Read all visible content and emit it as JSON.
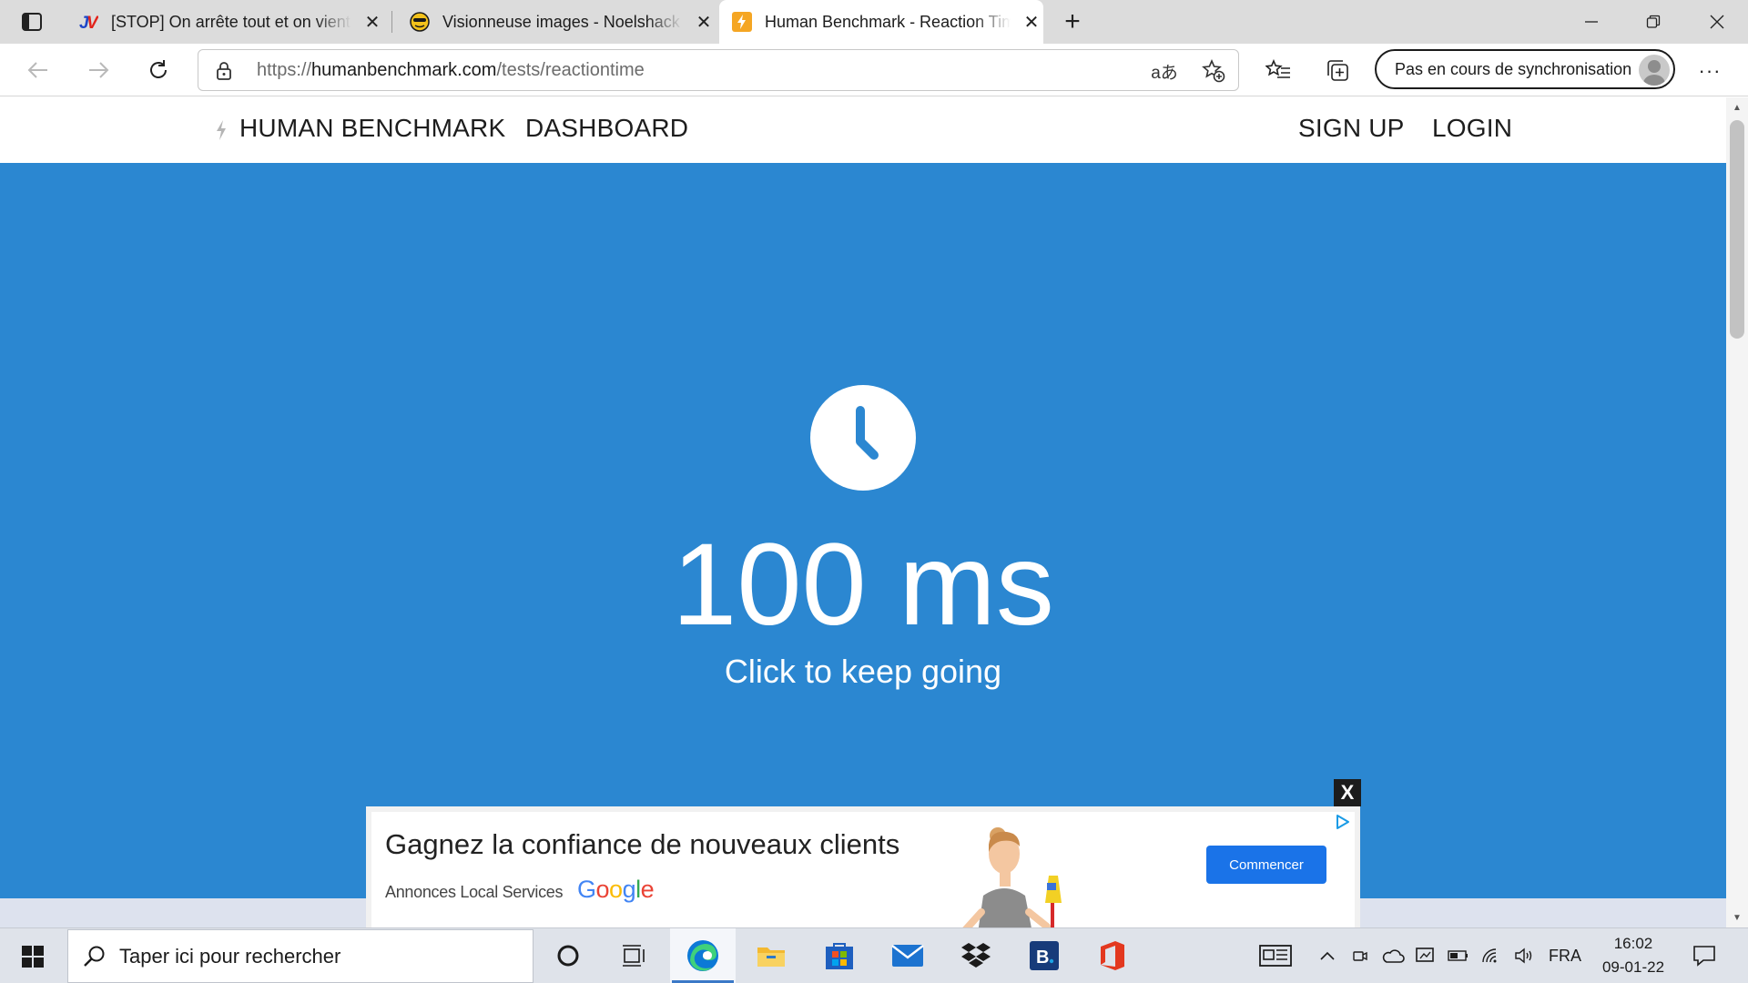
{
  "browser": {
    "tabs": [
      {
        "title": "[STOP] On arrête tout et on vient",
        "favicon": "jv-icon",
        "active": false
      },
      {
        "title": "Visionneuse images - Noelshack",
        "favicon": "noelshack-icon",
        "active": false
      },
      {
        "title": "Human Benchmark - Reaction Time",
        "favicon": "bolt-icon",
        "active": true
      }
    ],
    "address": {
      "scheme_prefix": "https://",
      "host": "humanbenchmark.com",
      "path": "/tests/reactiontime"
    },
    "sync_label": "Pas en cours de synchronisation",
    "read_aloud_glyph": "aあ"
  },
  "site": {
    "brand": "HUMAN BENCHMARK",
    "nav": {
      "dashboard": "DASHBOARD",
      "signup": "SIGN UP",
      "login": "LOGIN"
    },
    "accent_color": "#2b87d1"
  },
  "test": {
    "result": "100 ms",
    "hint": "Click to keep going"
  },
  "ad": {
    "close_label": "X",
    "headline": "Gagnez la confiance de nouveaux clients",
    "subline": "Annonces Local Services",
    "google_letters": [
      "G",
      "o",
      "o",
      "g",
      "l",
      "e"
    ],
    "google_colors": [
      "#4285f4",
      "#ea4335",
      "#fbbc05",
      "#4285f4",
      "#34a853",
      "#ea4335"
    ],
    "cta": "Commencer"
  },
  "taskbar": {
    "search_placeholder": "Taper ici pour rechercher",
    "language": "FRA",
    "time": "16:02",
    "date": "09-01-22"
  }
}
